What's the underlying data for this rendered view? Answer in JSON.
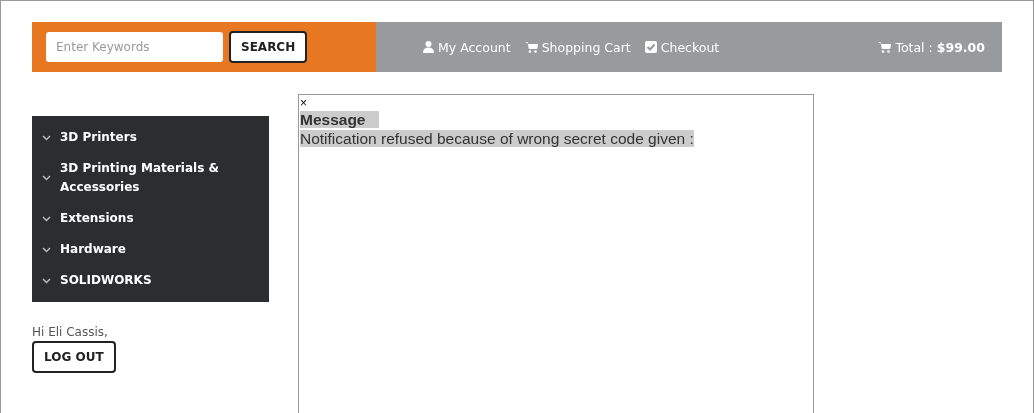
{
  "search": {
    "placeholder": "Enter Keywords",
    "button": "SEARCH"
  },
  "nav": [
    {
      "kind": "user",
      "label": "My Account"
    },
    {
      "kind": "cart",
      "label": "Shopping Cart"
    },
    {
      "kind": "check",
      "label": "Checkout"
    }
  ],
  "total": {
    "kind": "cart",
    "label": "Total : **$99.00**"
  },
  "sidebar": {
    "items": [
      {
        "label": "3D Printers"
      },
      {
        "label": "3D Printing Materials & Accessories"
      },
      {
        "label": "Extensions"
      },
      {
        "label": "Hardware"
      },
      {
        "label": "SOLIDWORKS"
      }
    ]
  },
  "user": {
    "greeting": "Hi Eli Cassis,",
    "button": "LOG OUT"
  },
  "message": {
    "close": "×",
    "title": "Message",
    "text": "Notification refused because of wrong secret code given :"
  }
}
